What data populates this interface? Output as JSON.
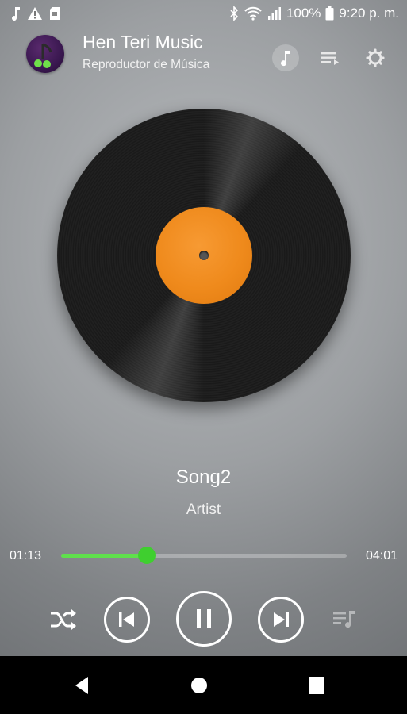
{
  "status_bar": {
    "battery": "100%",
    "time": "9:20 p. m."
  },
  "header": {
    "title": "Hen Teri Music",
    "subtitle": "Reproductor de Música"
  },
  "now_playing": {
    "title": "Song2",
    "artist": "Artist",
    "current_time": "01:13",
    "total_time": "04:01",
    "progress_fraction": 0.3,
    "is_playing": true
  },
  "colors": {
    "accent_green": "#3fcf2f",
    "vinyl_label_orange": "#ef8a1c"
  },
  "icons": {
    "header_music": "music-note-icon",
    "header_queue": "queue-icon",
    "header_settings": "gear-icon",
    "shuffle": "shuffle-icon",
    "previous": "skip-previous-icon",
    "pause": "pause-icon",
    "next": "skip-next-icon",
    "playlist": "playlist-icon"
  }
}
